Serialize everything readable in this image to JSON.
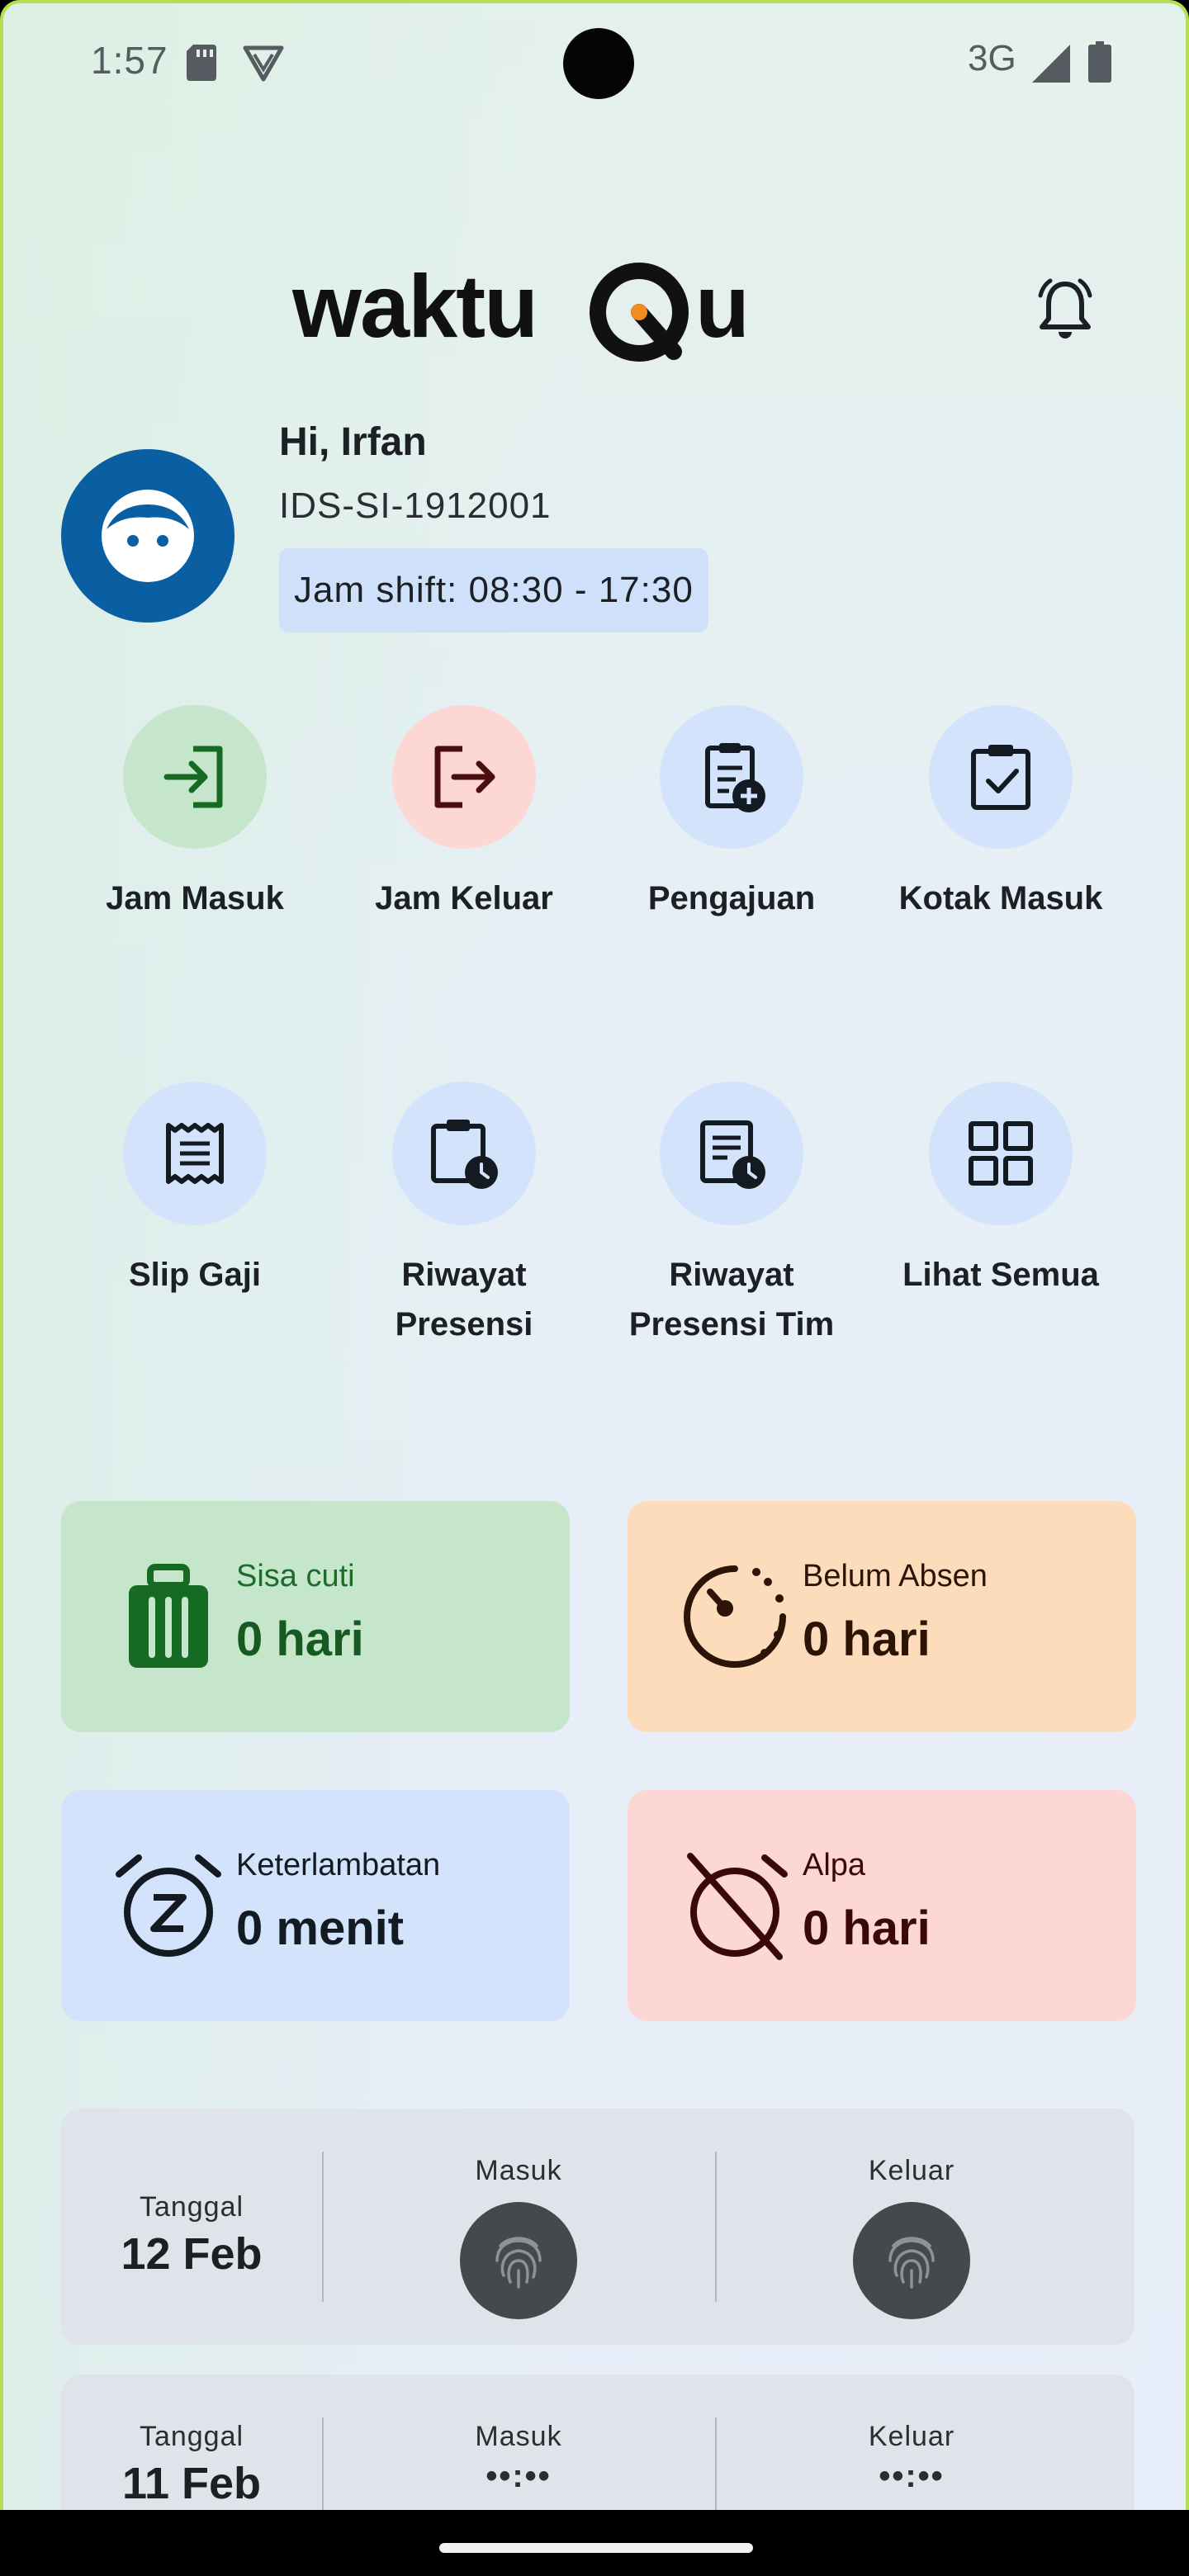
{
  "status_bar": {
    "time": "1:57",
    "network": "3G"
  },
  "header": {
    "brand": "waktuQu"
  },
  "profile": {
    "greeting": "Hi, Irfan",
    "employee_id": "IDS-SI-1912001",
    "shift": "Jam shift: 08:30 - 17:30"
  },
  "menu": [
    {
      "label": "Jam Masuk",
      "icon": "login-icon"
    },
    {
      "label": "Jam Keluar",
      "icon": "logout-icon"
    },
    {
      "label": "Pengajuan",
      "icon": "clipboard-add-icon"
    },
    {
      "label": "Kotak Masuk",
      "icon": "clipboard-check-icon"
    },
    {
      "label": "Slip Gaji",
      "icon": "receipt-icon"
    },
    {
      "label": "Riwayat Presensi",
      "icon": "clipboard-clock-icon"
    },
    {
      "label": "Riwayat Presensi Tim",
      "icon": "document-clock-icon"
    },
    {
      "label": "Lihat Semua",
      "icon": "grid-icon"
    }
  ],
  "stats": [
    {
      "label": "Sisa cuti",
      "value": "0 hari",
      "icon": "luggage-icon",
      "color": "#c6e6cc"
    },
    {
      "label": "Belum Absen",
      "value": "0 hari",
      "icon": "timer-icon",
      "color": "#fddcbc"
    },
    {
      "label": "Keterlambatan",
      "value": "0 menit",
      "icon": "alarm-snooze-icon",
      "color": "#d3e3fb"
    },
    {
      "label": "Alpa",
      "value": "0 hari",
      "icon": "alarm-off-icon",
      "color": "#fcd7d4"
    }
  ],
  "attendance": {
    "date_label": "Tanggal",
    "in_label": "Masuk",
    "out_label": "Keluar",
    "rows": [
      {
        "date": "12 Feb",
        "in": "",
        "out": ""
      },
      {
        "date": "11 Feb",
        "in": "••:••",
        "out": "••:••"
      }
    ]
  },
  "colors": {
    "primary": "#0a5ea2",
    "accent": "#f28c1e"
  }
}
